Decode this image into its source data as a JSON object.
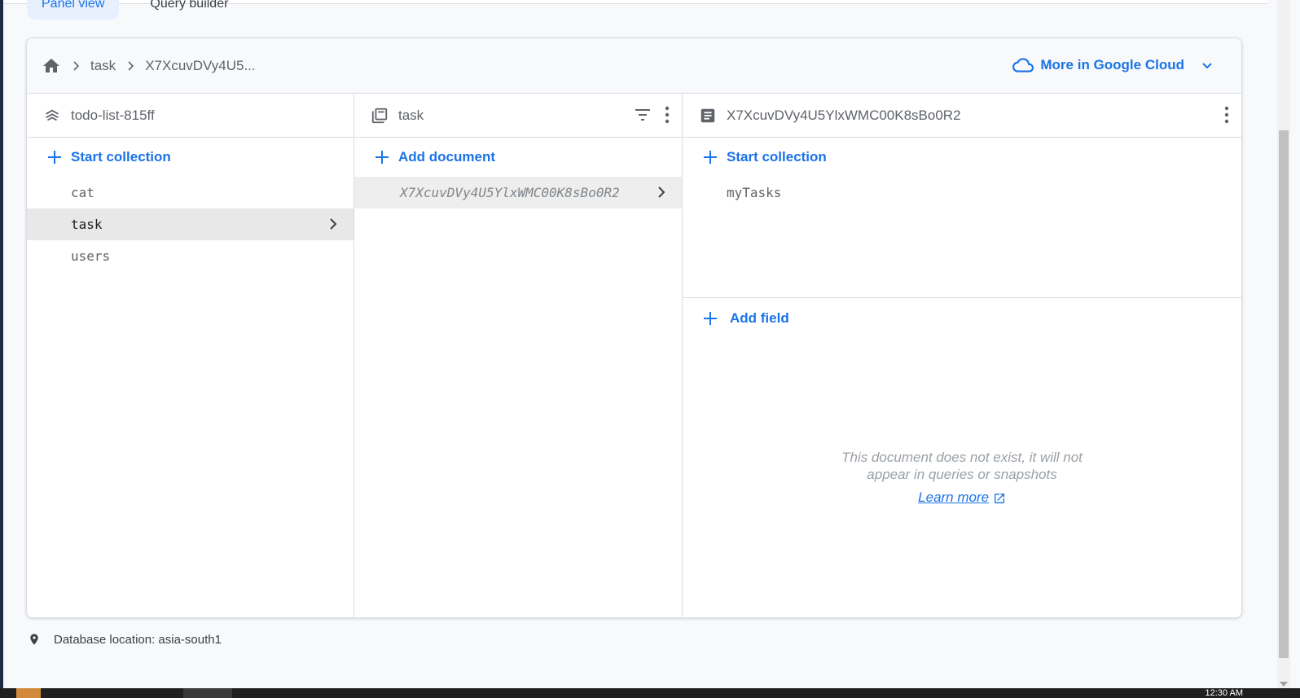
{
  "view_tabs": [
    {
      "label": "Panel view",
      "active": true
    },
    {
      "label": "Query builder",
      "active": false
    }
  ],
  "breadcrumb": {
    "items": [
      "task",
      "X7XcuvDVy4U5..."
    ],
    "cloud_link": "More in Google Cloud"
  },
  "panel_root": {
    "title": "todo-list-815ff",
    "add_label": "Start collection",
    "items": [
      "cat",
      "task",
      "users"
    ],
    "selected": "task"
  },
  "panel_collection": {
    "title": "task",
    "add_label": "Add document",
    "items": [
      "X7XcuvDVy4U5YlxWMC00K8sBo0R2"
    ]
  },
  "panel_document": {
    "title": "X7XcuvDVy4U5YlxWMC00K8sBo0R2",
    "add_collection_label": "Start collection",
    "subcollections": [
      "myTasks"
    ],
    "add_field_label": "Add field",
    "empty_message_line1": "This document does not exist, it will not",
    "empty_message_line2": "appear in queries or snapshots",
    "learn_more": "Learn more"
  },
  "footer": {
    "location": "Database location: asia-south1"
  },
  "taskbar": {
    "clock": "12:30 AM"
  },
  "colors": {
    "accent": "#1a73e8",
    "selected_row": "#e8e8e8",
    "border": "#dadce0"
  },
  "icons": [
    "home-icon",
    "chevron-right-icon",
    "cloud-icon",
    "chevron-down-icon",
    "firestore-icon",
    "collection-icon",
    "filter-icon",
    "more-vert-icon",
    "document-icon",
    "plus-icon",
    "open-in-new-icon",
    "location-pin-icon"
  ]
}
